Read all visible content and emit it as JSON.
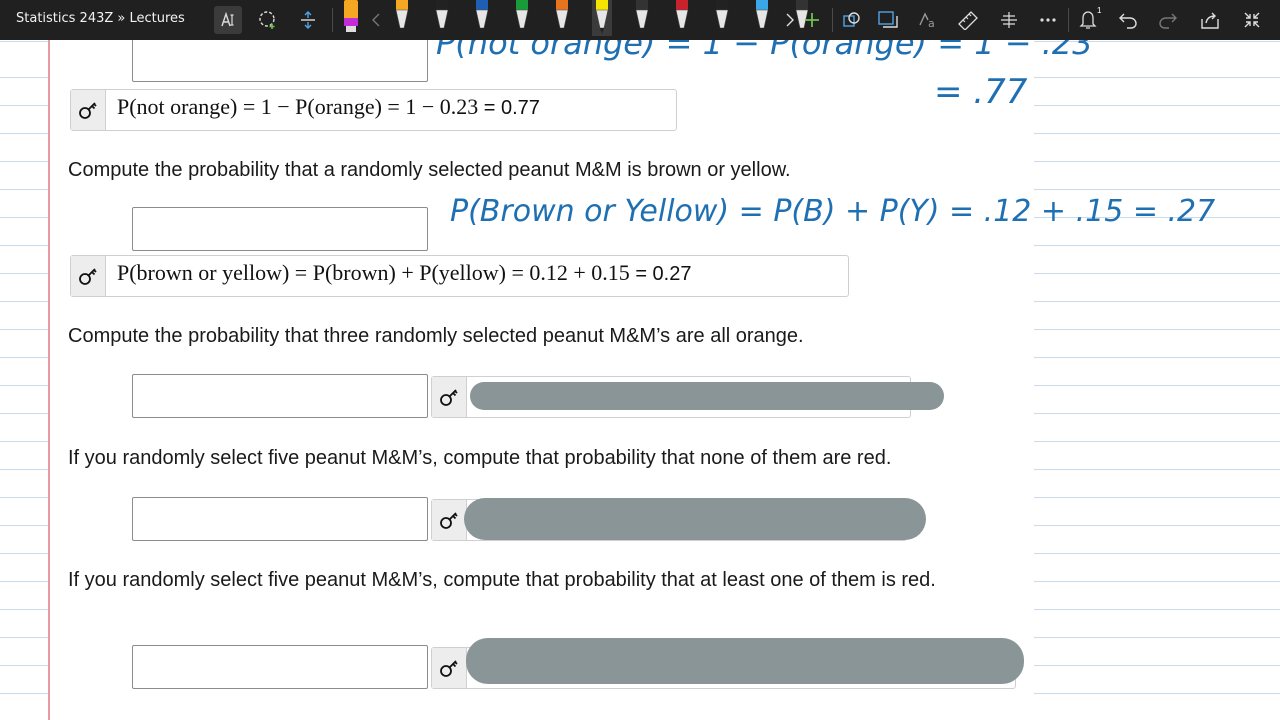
{
  "toolbar": {
    "breadcrumb": "Statistics 243Z » Lectures",
    "notification_count": "1",
    "pen_colors": [
      "#f5a623",
      "#222222",
      "#1e5fb4",
      "#1a9b3a",
      "#e6731e",
      "#f5e400",
      "#333333",
      "#c8232c",
      "#222222",
      "#3aa7e8",
      "#333333"
    ],
    "active_pen_index": 5
  },
  "questions": [
    {
      "text": "Compute the probability that a randomly selected peanut M&M is brown or yellow.",
      "formula": "P(brown or yellow) = P(brown) + P(yellow) = 0.12 + 0.15",
      "answer": "= 0.27",
      "ink": "P(Brown or Yellow) = P(B) + P(Y) = .12 + .15 = .27"
    },
    {
      "text": "Compute the probability that three randomly selected peanut M&M’s are all orange."
    },
    {
      "text": "If you randomly select five peanut M&M’s, compute that probability that none of them are red."
    },
    {
      "text": "If you randomly select five peanut M&M’s, compute that probability that at least one of them is red."
    }
  ],
  "previous": {
    "formula": "P(not  orange) = 1 − P(orange) = 1 − 0.23",
    "answer": "= 0.77",
    "ink_top": "P(not orange) = 1 − P(orange) = 1 − .23",
    "ink_result": "= .77"
  },
  "colors": {
    "ink": "#1f6fb3",
    "redaction": "#8a9597",
    "margin": "#e89aa3",
    "rule": "#c9dcee"
  }
}
